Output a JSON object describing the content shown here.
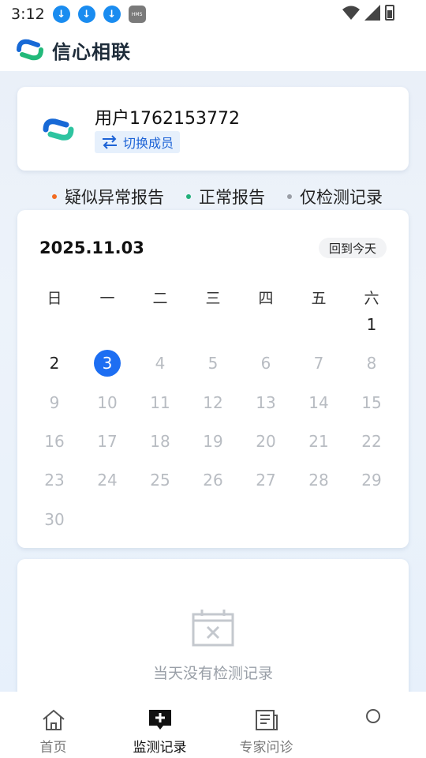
{
  "status_bar": {
    "time": "3:12",
    "notification_icons": [
      "download-icon",
      "download-icon",
      "download-icon",
      "hms-icon"
    ],
    "hms_label": "HMS"
  },
  "app": {
    "title": "信心相联"
  },
  "user": {
    "name": "用户1762153772",
    "switch_label": "切换成员"
  },
  "legend": [
    {
      "label": "疑似异常报告",
      "color": "#f26b21"
    },
    {
      "label": "正常报告",
      "color": "#21b07a"
    },
    {
      "label": "仅检测记录",
      "color": "#9a9ea6"
    }
  ],
  "calendar": {
    "current_date": "2025.11.03",
    "today_label": "回到今天",
    "weekdays": [
      "日",
      "一",
      "二",
      "三",
      "四",
      "五",
      "六"
    ],
    "first_weekday_index": 6,
    "days_in_month": 30,
    "selected_day": 3,
    "enabled_days": [
      1,
      2,
      3
    ]
  },
  "empty_state": {
    "message": "当天没有检测记录"
  },
  "bottom_nav": [
    {
      "label": "首页",
      "icon": "home-icon",
      "active": false
    },
    {
      "label": "监测记录",
      "icon": "record-add-icon",
      "active": true
    },
    {
      "label": "专家问诊",
      "icon": "newspaper-icon",
      "active": false
    },
    {
      "label": "",
      "icon": "profile-icon",
      "active": false
    }
  ],
  "colors": {
    "accent": "#1d6ef2",
    "switch_bg": "#e6f0fc",
    "dim_text": "#b8bcc2"
  }
}
